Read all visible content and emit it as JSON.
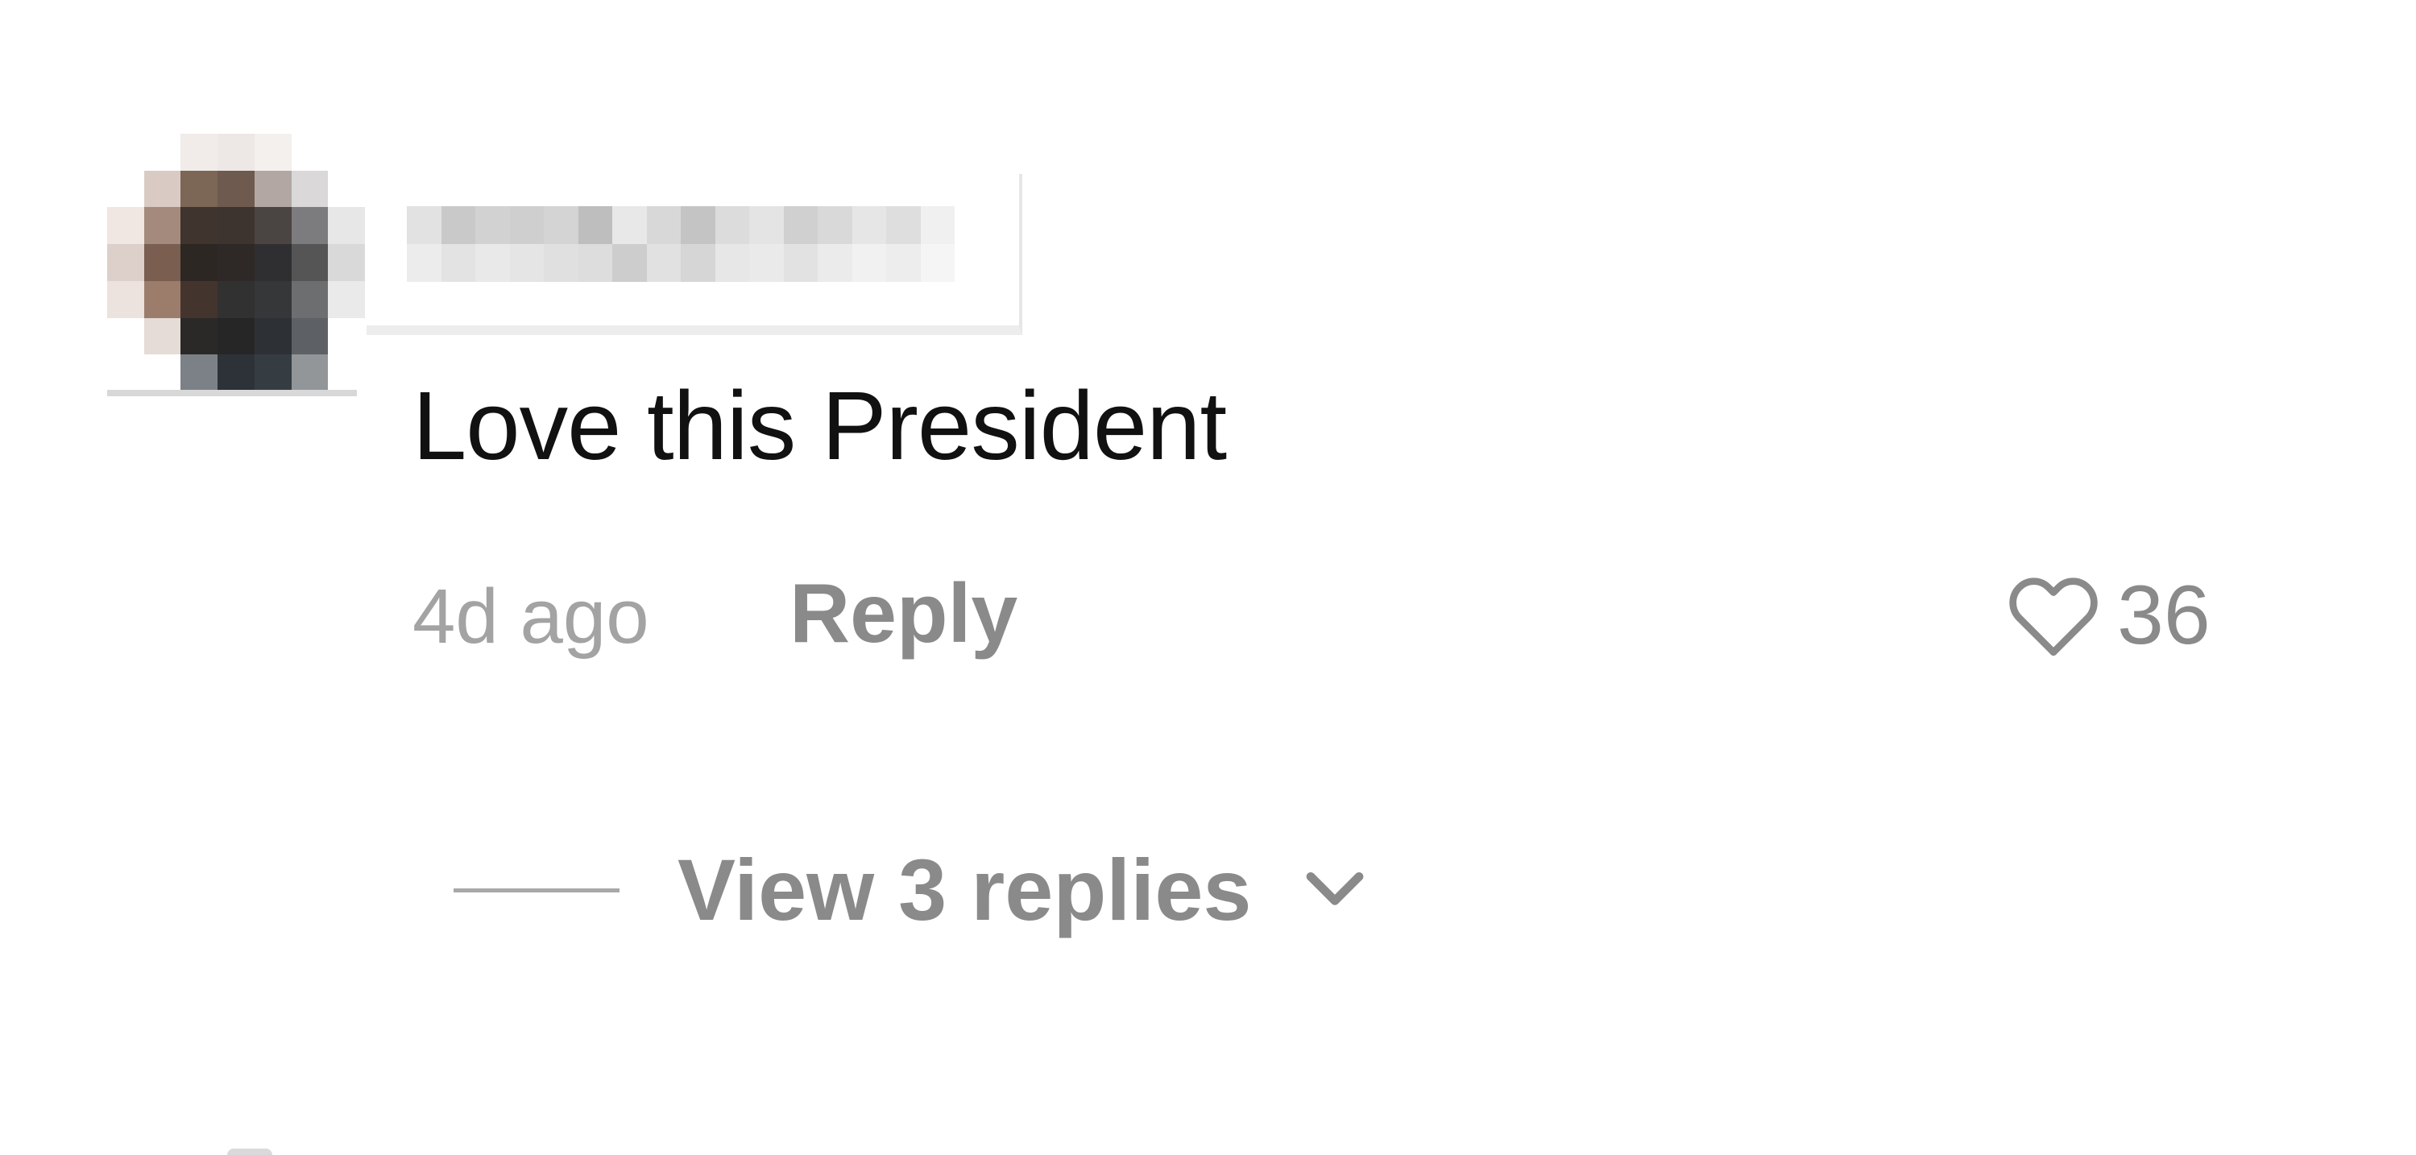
{
  "comment": {
    "username": "",
    "text": "Love this President",
    "timestamp": "4d ago",
    "reply_label": "Reply",
    "like_count": "36",
    "view_replies_label": "View 3 replies"
  },
  "colors": {
    "text_primary": "#111111",
    "text_secondary": "#8a8a8a",
    "timestamp": "#a3a3a3"
  },
  "icons": {
    "like": "heart-outline-icon",
    "expand": "chevron-down-icon"
  }
}
